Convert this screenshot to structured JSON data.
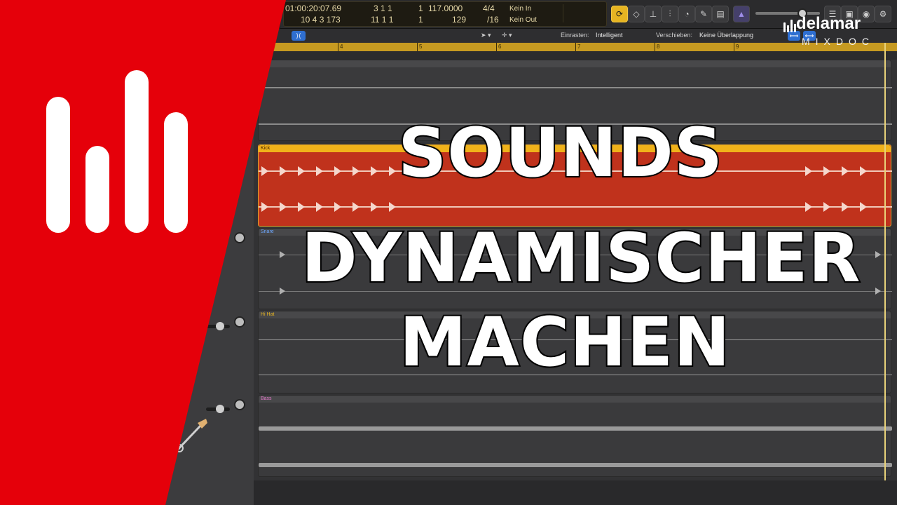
{
  "transport": {
    "time": "01:00:20:07.69",
    "bars_top": "3  1  1",
    "bars_top_2": "1",
    "tempo": "117.0000",
    "signature": "4/4",
    "in_label": "Kein In",
    "bars_bottom": "10  4  3  173",
    "bars_bottom_2": "11  1  1",
    "bars_bottom_3": "1",
    "tempo_bottom": "129",
    "division": "/16",
    "out_label": "Kein Out"
  },
  "toolbar": {
    "snap_label": "Einrasten:",
    "snap_value": "Intelligent",
    "move_label": "Verschieben:",
    "move_value": "Keine Überlappung"
  },
  "ruler": {
    "marks": [
      "4",
      "5",
      "6",
      "7",
      "8",
      "9"
    ]
  },
  "tracks": [
    {
      "name": "",
      "color": "#3a3a3c"
    },
    {
      "name": "Kick",
      "color": "#c0321c"
    },
    {
      "name": "Snare",
      "color": "#3a3a3c"
    },
    {
      "name": "Hi Hat",
      "color": "#3a3a3c"
    },
    {
      "name": "Bass",
      "color": "#3a3a3c"
    }
  ],
  "headline": {
    "line1": "SOUNDS",
    "line2": "DYNAMISCHER",
    "line3": "MACHEN"
  },
  "brand": {
    "name": "delamar",
    "sub": "MIXDOC",
    "red": "#e5000a"
  },
  "icons": [
    "cycle-icon",
    "metronome-icon",
    "mixer-icon",
    "eq-icon",
    "tuner-icon",
    "edit-icon",
    "notes-icon",
    "tuner-triangle-icon",
    "list-icon",
    "browser-icon",
    "info-icon",
    "settings-icon",
    "pointer-tool-icon",
    "crosshair-tool-icon",
    "guitar-icon"
  ]
}
